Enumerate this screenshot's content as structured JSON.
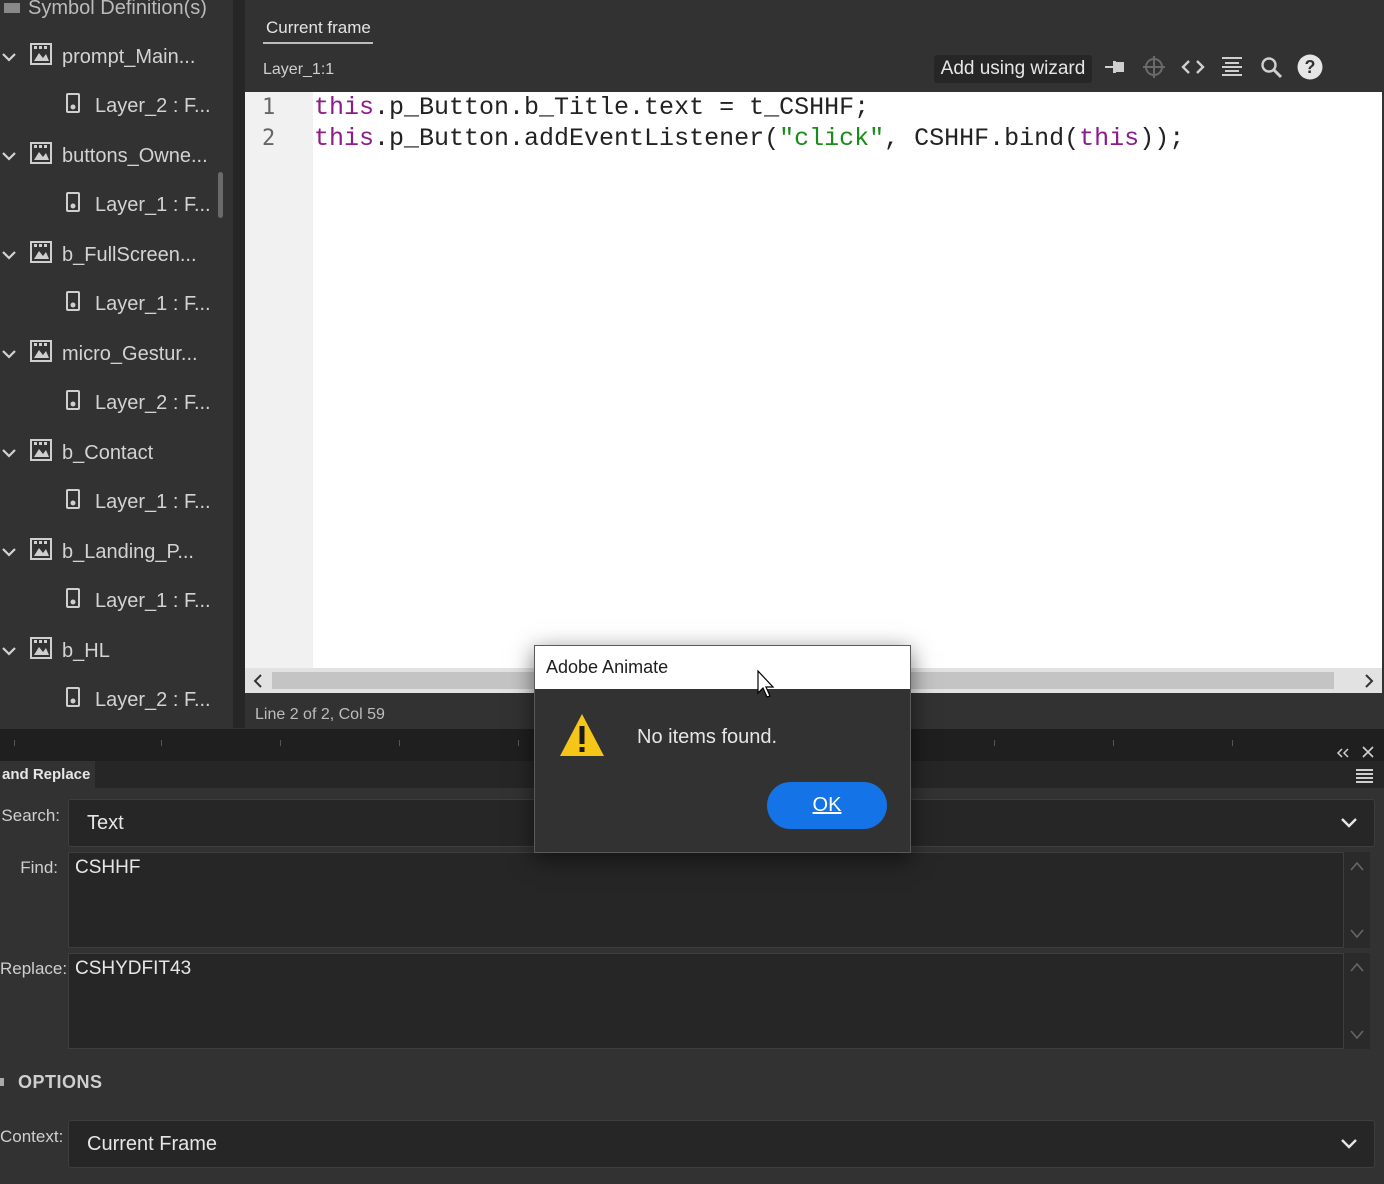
{
  "tree": {
    "partial_header": "Symbol Definition(s)",
    "items": [
      {
        "label": "prompt_Main...",
        "type": "symbol"
      },
      {
        "label": "Layer_2 : F...",
        "type": "layer"
      },
      {
        "label": "buttons_Owne...",
        "type": "symbol"
      },
      {
        "label": "Layer_1 : F...",
        "type": "layer"
      },
      {
        "label": "b_FullScreen...",
        "type": "symbol"
      },
      {
        "label": "Layer_1 : F...",
        "type": "layer"
      },
      {
        "label": "micro_Gestur...",
        "type": "symbol"
      },
      {
        "label": "Layer_2 : F...",
        "type": "layer"
      },
      {
        "label": "b_Contact",
        "type": "symbol"
      },
      {
        "label": "Layer_1 : F...",
        "type": "layer"
      },
      {
        "label": "b_Landing_P...",
        "type": "symbol"
      },
      {
        "label": "Layer_1 : F...",
        "type": "layer"
      },
      {
        "label": "b_HL",
        "type": "symbol"
      },
      {
        "label": "Layer_2 : F...",
        "type": "layer"
      }
    ]
  },
  "actions": {
    "tab_label": "Current frame",
    "layer_label": "Layer_1:1",
    "wizard_label": "Add using wizard",
    "toolbar_icons": [
      "pin-icon",
      "target-icon",
      "code-snippets-icon",
      "format-code-icon",
      "find-icon",
      "help-icon"
    ],
    "line_numbers": [
      "1",
      "2"
    ],
    "code_lines": [
      "this.p_Button.b_Title.text = t_CSHHF;",
      "this.p_Button.addEventListener(\"click\", CSHHF.bind(this));"
    ],
    "status": "Line 2 of 2, Col 59"
  },
  "find_replace": {
    "panel_title": "and Replace",
    "search_label": "Search:",
    "search_value": "Text",
    "find_label": "Find:",
    "find_value": "CSHHF",
    "replace_label": "Replace:",
    "replace_value": "CSHYDFIT43",
    "options_label": "OPTIONS",
    "context_label": "Context:",
    "context_value": "Current Frame"
  },
  "dialog": {
    "title": "Adobe Animate",
    "message": "No items found.",
    "ok_label": "OK"
  },
  "colors": {
    "accent": "#1473e6",
    "panel_bg": "#323232",
    "warning": "#f5c518",
    "keyword": "#8c1c8c",
    "string": "#1a8c1a"
  }
}
